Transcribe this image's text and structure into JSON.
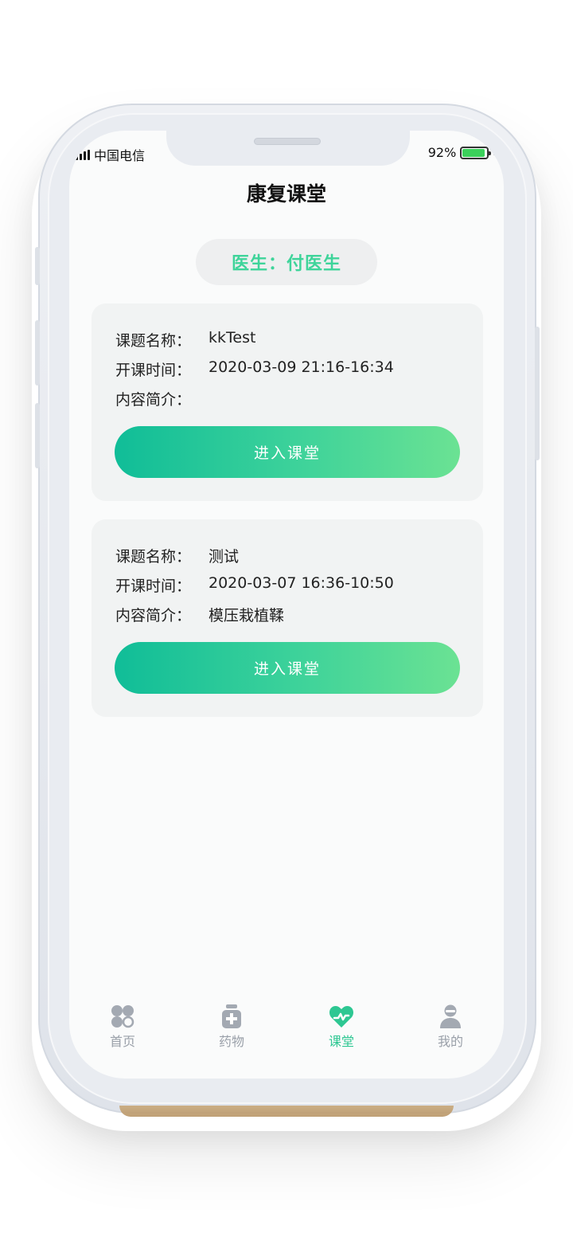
{
  "status_bar": {
    "carrier": "中国电信",
    "battery_percent": "92%",
    "battery_level": 0.92
  },
  "header": {
    "title": "康复课堂"
  },
  "doctor": {
    "label": "医生：付医生"
  },
  "courses": [
    {
      "topic_label": "课题名称：",
      "topic_value": "kkTest",
      "time_label": "开课时间：",
      "time_value": "2020-03-09 21:16-16:34",
      "intro_label": "内容简介：",
      "intro_value": "",
      "button_label": "进入课堂"
    },
    {
      "topic_label": "课题名称：",
      "topic_value": "测试",
      "time_label": "开课时间：",
      "time_value": "2020-03-07 16:36-10:50",
      "intro_label": "内容简介：",
      "intro_value": "模压栽植鞣",
      "button_label": "进入课堂"
    }
  ],
  "tabbar": {
    "items": [
      {
        "label": "首页",
        "icon": "home-grid-icon",
        "active": false
      },
      {
        "label": "药物",
        "icon": "medicine-bottle-icon",
        "active": false
      },
      {
        "label": "课堂",
        "icon": "heart-pulse-icon",
        "active": true
      },
      {
        "label": "我的",
        "icon": "user-icon",
        "active": false
      }
    ]
  },
  "colors": {
    "accent": "#3ed49a",
    "button_gradient_start": "#10bd98",
    "button_gradient_end": "#6be293",
    "tab_inactive": "#9aa0a9"
  }
}
